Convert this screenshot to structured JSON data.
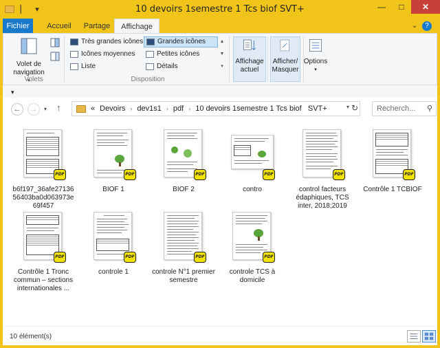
{
  "window": {
    "title": "10 devoirs 1semestre 1 Tcs biof   SVT+"
  },
  "ribbon_tabs": [
    "Fichier",
    "Accueil",
    "Partage",
    "Affichage"
  ],
  "ribbon": {
    "panes": {
      "nav_label": "Volet de\nnavigation",
      "group_label": "Volets"
    },
    "layout": {
      "items": [
        "Très grandes icônes",
        "Grandes icônes",
        "Icônes moyennes",
        "Petites icônes",
        "Liste",
        "Détails"
      ],
      "selected": "Grandes icônes",
      "group_label": "Disposition"
    },
    "current_view_label": "Affichage\nactuel",
    "show_hide_label": "Afficher/\nMasquer",
    "options_label": "Options"
  },
  "address": {
    "prefix": "«",
    "crumbs": [
      "Devoirs",
      "dev1s1",
      "pdf",
      "10 devoirs 1semestre 1 Tcs biof   SVT+"
    ]
  },
  "search": {
    "placeholder": "Recherch..."
  },
  "files": [
    {
      "name": "b6f197_36afe2713656403ba0d063973e69f457",
      "kind": "table"
    },
    {
      "name": "BIOF 1",
      "kind": "plant"
    },
    {
      "name": "BIOF 2",
      "kind": "plant2"
    },
    {
      "name": "contro",
      "kind": "land"
    },
    {
      "name": "control  facteurs édaphiques, TCS inter, 2018;2019",
      "kind": "text"
    },
    {
      "name": "Contrôle  1 TCBIOF",
      "kind": "table2"
    },
    {
      "name": "Contrôle  1 Tronc commun – sections internationales ...",
      "kind": "table3"
    },
    {
      "name": "controle 1",
      "kind": "text2"
    },
    {
      "name": "controle N°1 premier semestre",
      "kind": "text3"
    },
    {
      "name": "controle TCS à domicile",
      "kind": "plant3"
    }
  ],
  "status": {
    "count_text": "10 élément(s)"
  },
  "colors": {
    "titlebar": "#f0c419",
    "file_tab": "#1979ca",
    "close_button": "#c7403a",
    "pdf_badge": "#f3e300"
  }
}
